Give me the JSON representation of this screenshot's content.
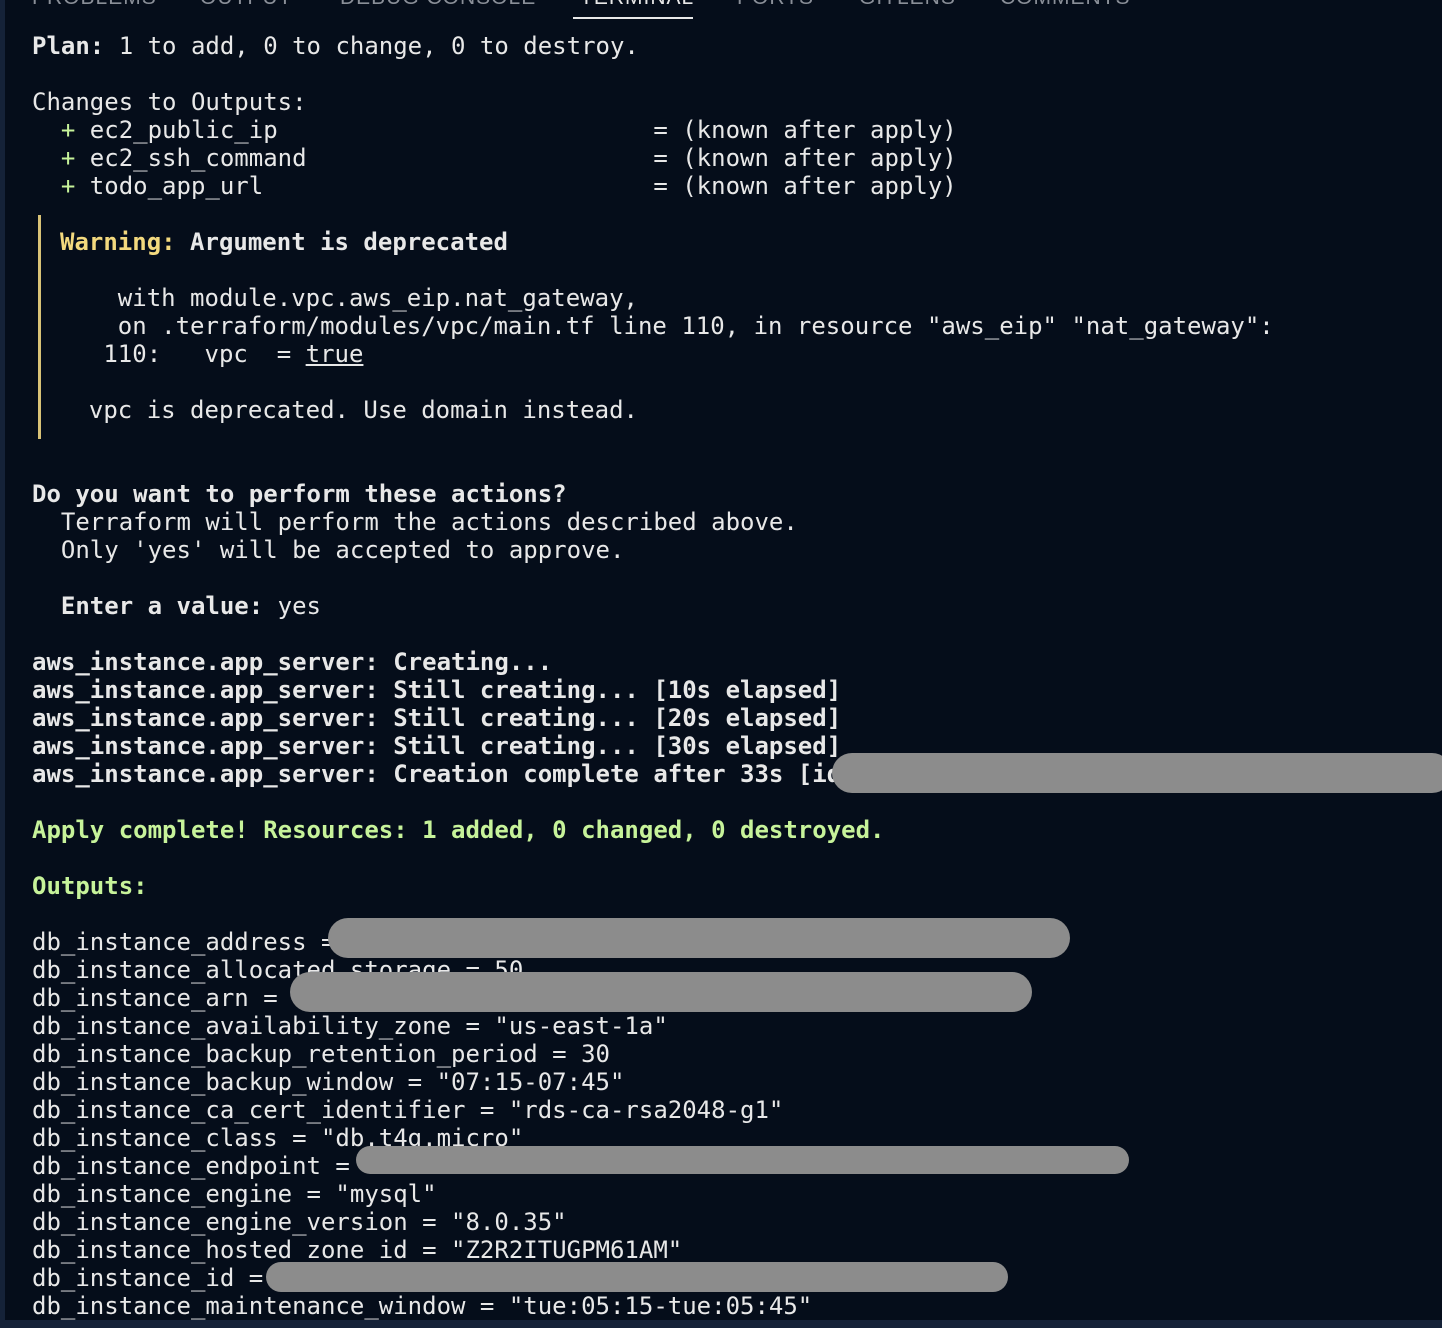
{
  "panel": {
    "tabs": [
      {
        "label": "PROBLEMS"
      },
      {
        "label": "OUTPUT"
      },
      {
        "label": "DEBUG CONSOLE"
      },
      {
        "label": "TERMINAL"
      },
      {
        "label": "PORTS"
      },
      {
        "label": "GITLENS"
      },
      {
        "label": "COMMENTS"
      }
    ],
    "active_tab": "TERMINAL"
  },
  "terminal": {
    "plan": {
      "label": "Plan:",
      "text": " 1 to add, 0 to change, 0 to destroy."
    },
    "changes_header": "Changes to Outputs:",
    "output_changes": [
      {
        "sign": "  + ",
        "text": "ec2_public_ip                          = (known after apply)"
      },
      {
        "sign": "  + ",
        "text": "ec2_ssh_command                        = (known after apply)"
      },
      {
        "sign": "  + ",
        "text": "todo_app_url                           = (known after apply)"
      }
    ],
    "warning": {
      "label": "Warning:",
      "title": " Argument is deprecated",
      "with_line": "    with module.vpc.aws_eip.nat_gateway,",
      "on_line": "    on .terraform/modules/vpc/main.tf line 110, in resource \"aws_eip\" \"nat_gateway\":",
      "code_prefix": "   110:   vpc  = ",
      "code_value": "true",
      "message": "  vpc is deprecated. Use domain instead."
    },
    "prompt": {
      "question": "Do you want to perform these actions?",
      "line1": "  Terraform will perform the actions described above.",
      "line2": "  Only 'yes' will be accepted to approve.",
      "enter_label": "  Enter a value:",
      "enter_value": " yes"
    },
    "progress": [
      {
        "resource": "aws_instance.app_server:",
        "status": " Creating..."
      },
      {
        "resource": "aws_instance.app_server:",
        "status": " Still creating... [10s elapsed]"
      },
      {
        "resource": "aws_instance.app_server:",
        "status": " Still creating... [20s elapsed]"
      },
      {
        "resource": "aws_instance.app_server:",
        "status": " Still creating... [30s elapsed]"
      },
      {
        "resource": "aws_instance.app_server:",
        "status": " Creation complete after 33s [id="
      }
    ],
    "apply_complete": "Apply complete! Resources: 1 added, 0 changed, 0 destroyed.",
    "outputs_header": "Outputs:",
    "outputs": [
      {
        "text": "db_instance_address ="
      },
      {
        "text": "db_instance_allocated_storage = 50"
      },
      {
        "text": "db_instance_arn = \""
      },
      {
        "text": "db_instance_availability_zone = \"us-east-1a\""
      },
      {
        "text": "db_instance_backup_retention_period = 30"
      },
      {
        "text": "db_instance_backup_window = \"07:15-07:45\""
      },
      {
        "text": "db_instance_ca_cert_identifier = \"rds-ca-rsa2048-g1\""
      },
      {
        "text": "db_instance_class = \"db.t4g.micro\""
      },
      {
        "text": "db_instance_endpoint = "
      },
      {
        "text": "db_instance_engine = \"mysql\""
      },
      {
        "text": "db_instance_engine_version = \"8.0.35\""
      },
      {
        "text": "db_instance_hosted_zone_id = \"Z2R2ITUGPM61AM\""
      },
      {
        "text": "db_instance_id = "
      },
      {
        "text": "db_instance_maintenance_window = \"tue:05:15-tue:05:45\""
      }
    ]
  }
}
